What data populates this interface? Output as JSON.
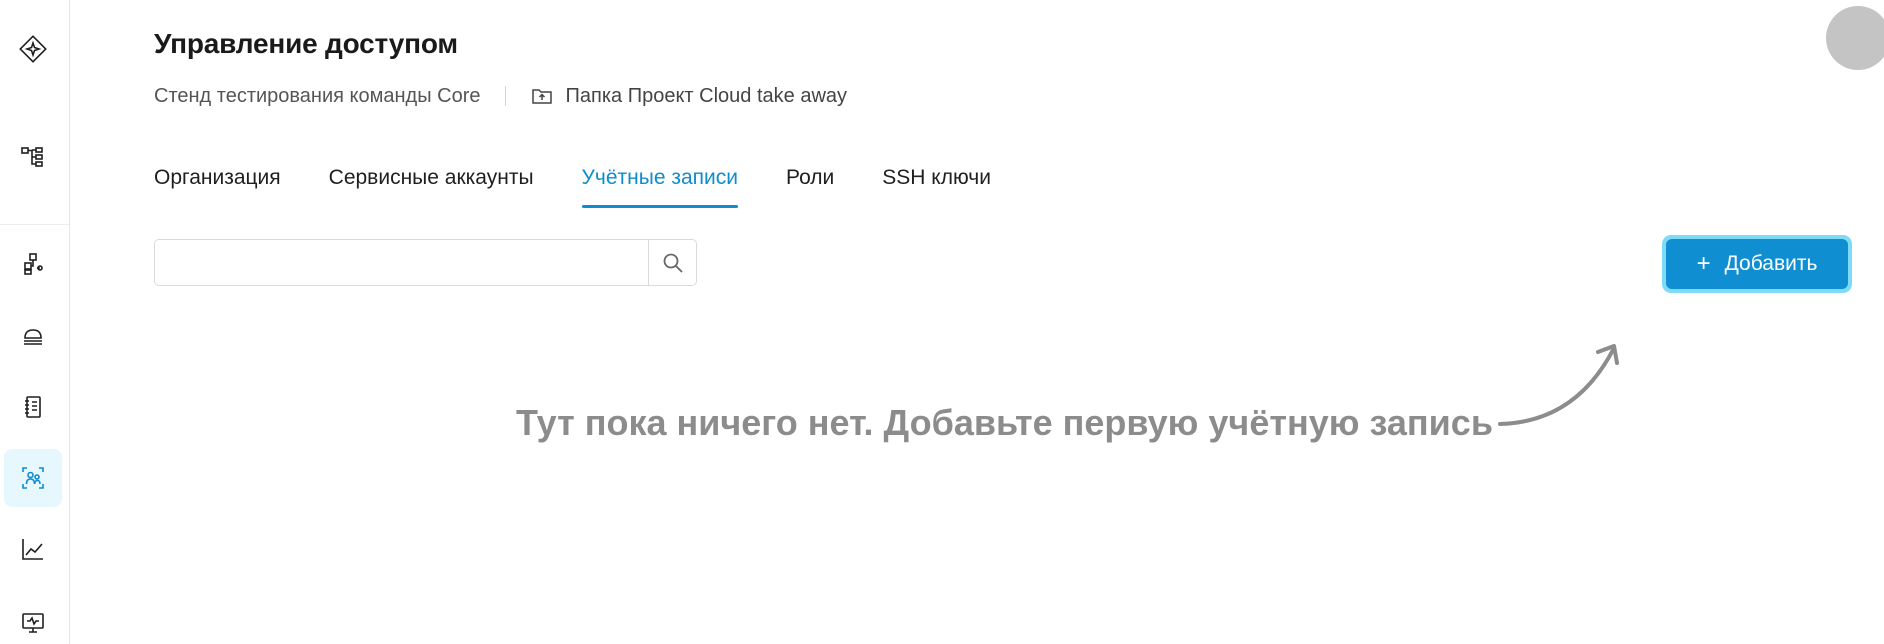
{
  "header": {
    "title": "Управление доступом",
    "org_name": "Стенд тестирования команды Core",
    "folder_label": "Папка Проект Cloud take away"
  },
  "tabs": [
    {
      "label": "Организация",
      "active": false
    },
    {
      "label": "Сервисные аккаунты",
      "active": false
    },
    {
      "label": "Учётные записи",
      "active": true
    },
    {
      "label": "Роли",
      "active": false
    },
    {
      "label": "SSH ключи",
      "active": false
    }
  ],
  "search": {
    "value": "",
    "placeholder": ""
  },
  "toolbar": {
    "add_label": "Добавить",
    "add_icon": "plus-icon"
  },
  "empty_state": {
    "message": "Тут пока ничего нет. Добавьте первую учётную запись"
  },
  "sidebar": {
    "items": [
      {
        "icon": "logo-icon",
        "active": false
      },
      {
        "icon": "hierarchy-icon",
        "active": false
      },
      {
        "icon": "services-icon",
        "active": false
      },
      {
        "icon": "cloud-icon",
        "active": false
      },
      {
        "icon": "notebook-icon",
        "active": false
      },
      {
        "icon": "users-access-icon",
        "active": true
      },
      {
        "icon": "chart-line-icon",
        "active": false
      },
      {
        "icon": "monitor-icon",
        "active": false
      }
    ]
  },
  "colors": {
    "accent": "#0e8ccf",
    "button": "#0f8ed2",
    "button_focus_ring": "#7fdaf5",
    "empty_text": "#8c8c8c",
    "active_sidebar_bg": "#e6f7fd"
  }
}
